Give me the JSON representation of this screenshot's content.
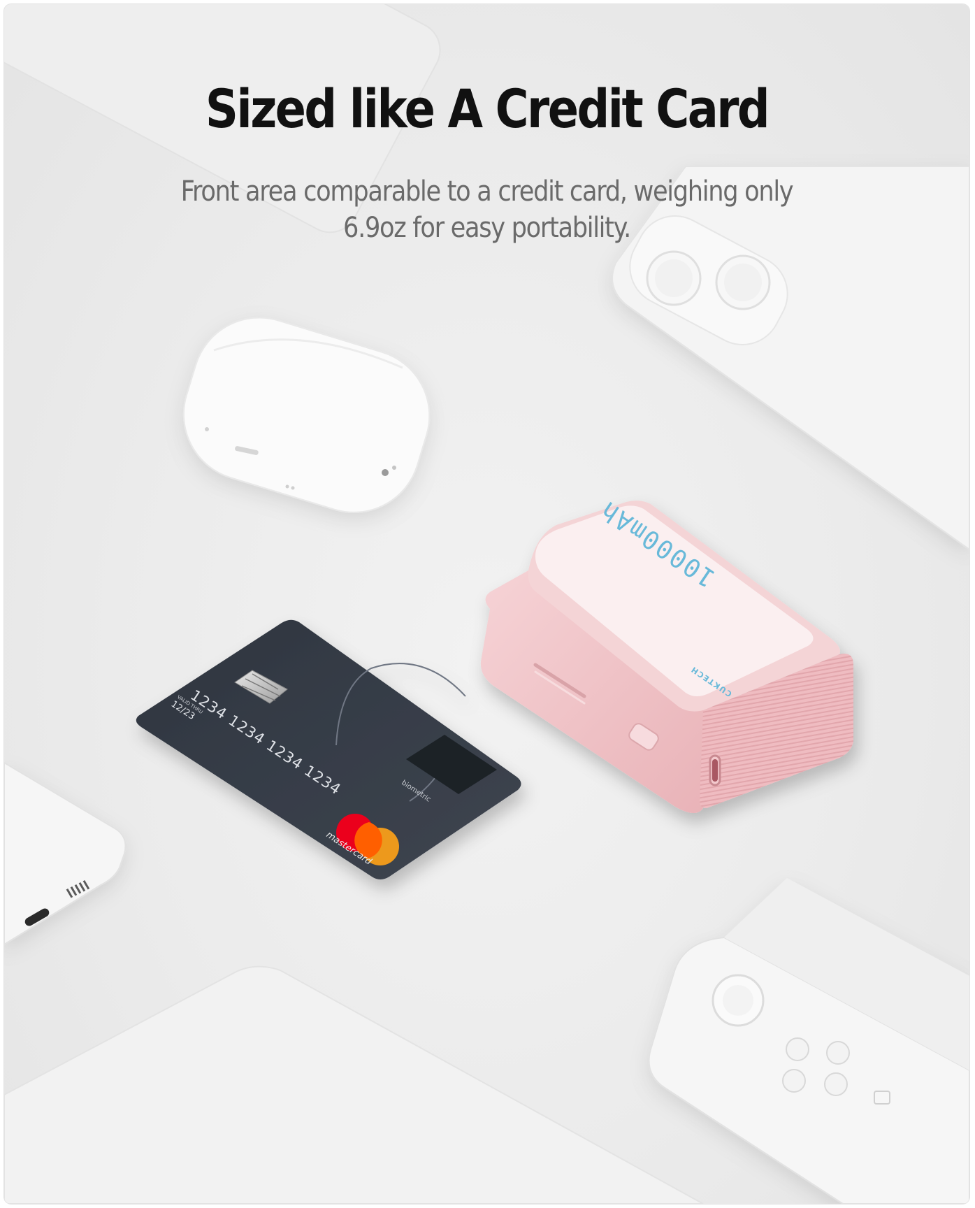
{
  "hero": {
    "title": "Sized like A Credit Card",
    "subtitle": "Front area comparable to a credit card, weighing only 6.9oz for easy portability."
  },
  "credit_card": {
    "number": "1234 1234 1234 1234",
    "expiry_label": "VALID THRU",
    "expiry": "12/23",
    "sensor_label": "biometric",
    "network": "mastercard"
  },
  "power_bank": {
    "capacity": "10000mAh",
    "brand": "CUKTECH"
  },
  "colors": {
    "background": "#ebebeb",
    "card": "#363c46",
    "power_bank_body": "#f2c6c9",
    "power_bank_top": "#fbeff0",
    "power_bank_text": "#68b9d9",
    "mastercard_red": "#eb001b",
    "mastercard_orange": "#f79e1b"
  }
}
